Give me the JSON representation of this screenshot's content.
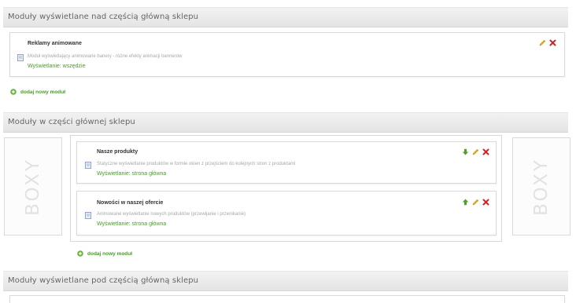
{
  "sections": [
    {
      "header": "Moduły wyświetlane nad częścią główną sklepu"
    },
    {
      "header": "Moduły w części głównej sklepu"
    },
    {
      "header": "Moduły wyświetlane pod częścią główną sklepu"
    }
  ],
  "modules": [
    {
      "title": "Reklamy animowane",
      "description": "Moduł wyświetlający animowane banery - różne efekty animacji bannerów",
      "display": "Wyświetlanie: wszędzie"
    },
    {
      "title": "Nasze produkty",
      "description": "Statyczne wyświetlanie produktów w formie okien z przejściem do kolejnych stron z produktami",
      "display": "Wyświetlanie: strona główna"
    },
    {
      "title": "Nowości w naszej ofercie",
      "description": "Animowane wyświetlanie nowych produktów (przewijanie i przenikanie)",
      "display": "Wyświetlanie: strona główna"
    }
  ],
  "add_module_label": "dodaj nowy moduł",
  "boxy_label": "BOXY",
  "colors": {
    "accent_green": "#4b9a2a",
    "delete_red": "#d62222",
    "edit_yellow": "#e0b020"
  },
  "icons": {
    "edit": "pencil-icon",
    "delete": "close-icon",
    "move_down": "arrow-down-icon",
    "move_up": "arrow-up-icon",
    "add": "plus-icon",
    "page": "page-icon"
  }
}
